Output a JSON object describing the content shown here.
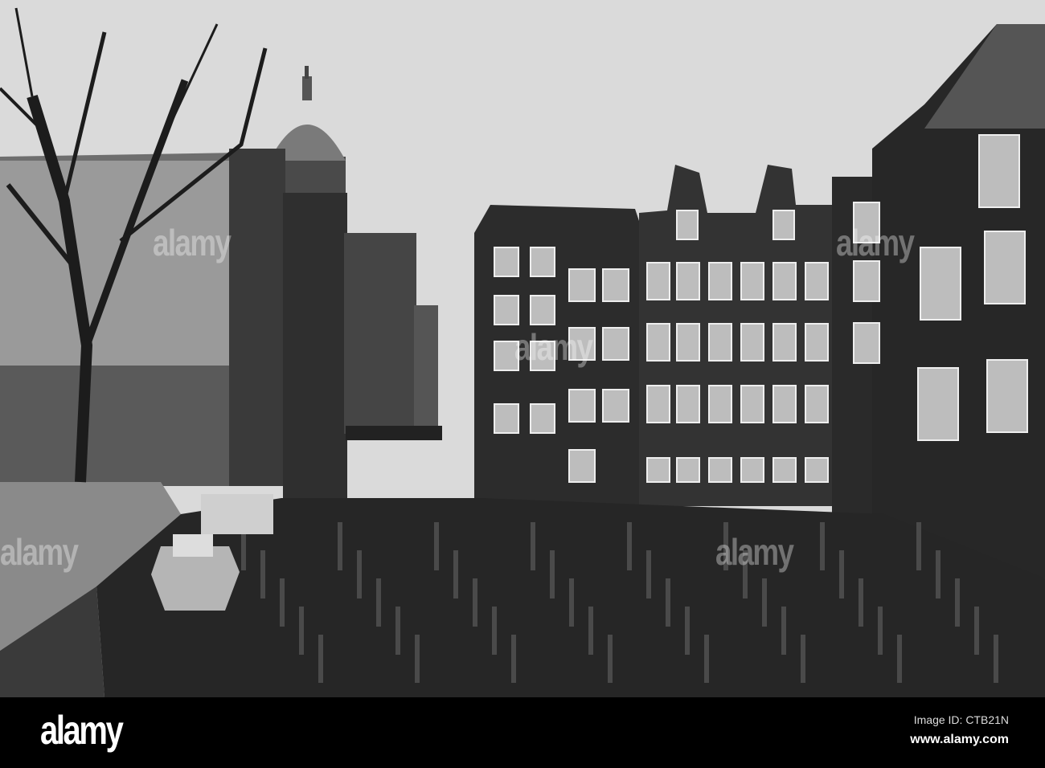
{
  "watermark": "alamy",
  "footer": {
    "logo": "alamy",
    "image_id": "Image ID: CTB21N",
    "website": "www.alamy.com"
  },
  "colors": {
    "sky": "#d9d9d9",
    "water": "#262626",
    "buildings": "#2e2e2e"
  }
}
